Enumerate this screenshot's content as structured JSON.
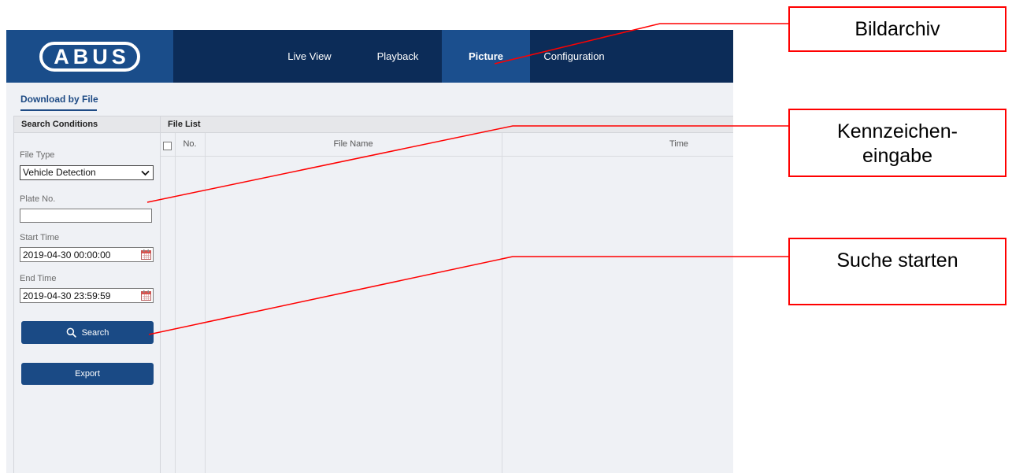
{
  "header": {
    "logo_text": "ABUS",
    "nav": [
      {
        "label": "Live View",
        "active": false
      },
      {
        "label": "Playback",
        "active": false
      },
      {
        "label": "Picture",
        "active": true
      },
      {
        "label": "Configuration",
        "active": false
      }
    ]
  },
  "subnav": {
    "tab_label": "Download by File"
  },
  "search_panel": {
    "title": "Search Conditions",
    "file_type": {
      "label": "File Type",
      "value": "Vehicle Detection",
      "icon": "chevron-down-icon"
    },
    "plate_no": {
      "label": "Plate No."
    },
    "start_time": {
      "label": "Start Time",
      "value": "2019-04-30 00:00:00",
      "icon": "calendar-icon"
    },
    "end_time": {
      "label": "End Time",
      "value": "2019-04-30 23:59:59",
      "icon": "calendar-icon"
    },
    "search_button": {
      "label": "Search",
      "icon": "search-icon"
    },
    "export_button": {
      "label": "Export"
    }
  },
  "file_list": {
    "title": "File List",
    "select_all_checked": false,
    "columns": [
      "No.",
      "File Name",
      "Time"
    ]
  },
  "annotations": [
    {
      "lines": [
        "Bildarchiv"
      ]
    },
    {
      "lines": [
        "Kennzeichen-",
        "eingabe"
      ]
    },
    {
      "lines": [
        "Suche starten"
      ]
    }
  ],
  "colors": {
    "header_bg": "#0c2c58",
    "logo_bg": "#1a4d8a",
    "active_tab_bg": "#1b4f8e",
    "button_bg": "#1a4a85",
    "accent_text": "#1d4a84",
    "annotation_red": "#ff0000"
  }
}
